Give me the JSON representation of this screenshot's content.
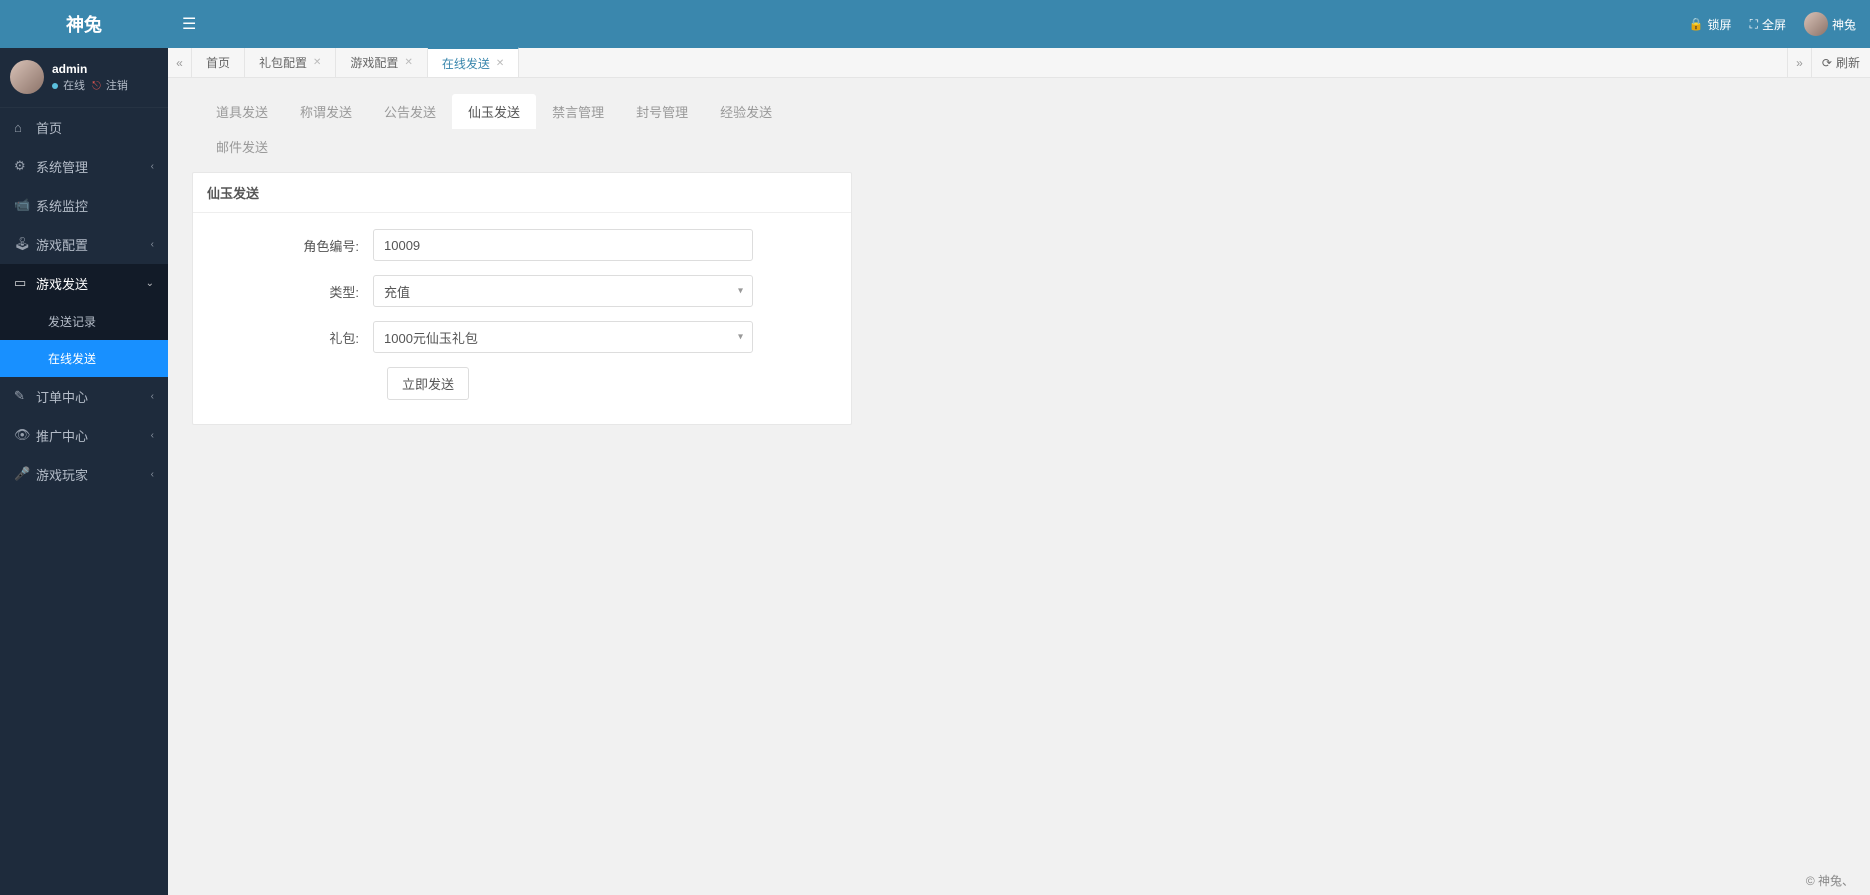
{
  "brand": "神兔",
  "user": {
    "name": "admin",
    "online": "在线",
    "logout": "注销"
  },
  "sidebar": [
    {
      "icon": "home",
      "label": "首页",
      "caret": false
    },
    {
      "icon": "gear",
      "label": "系统管理",
      "caret": true
    },
    {
      "icon": "camera",
      "label": "系统监控",
      "caret": false
    },
    {
      "icon": "dashboard",
      "label": "游戏配置",
      "caret": true
    },
    {
      "icon": "card",
      "label": "游戏发送",
      "caret": true,
      "open": true,
      "children": [
        {
          "label": "发送记录",
          "active": false
        },
        {
          "label": "在线发送",
          "active": true
        }
      ]
    },
    {
      "icon": "magic",
      "label": "订单中心",
      "caret": true
    },
    {
      "icon": "eye",
      "label": "推广中心",
      "caret": true
    },
    {
      "icon": "mic",
      "label": "游戏玩家",
      "caret": true
    }
  ],
  "topbar": {
    "lock": "锁屏",
    "fullscreen": "全屏",
    "username": "神兔"
  },
  "tabs": [
    {
      "label": "首页",
      "closable": false
    },
    {
      "label": "礼包配置",
      "closable": true
    },
    {
      "label": "游戏配置",
      "closable": true
    },
    {
      "label": "在线发送",
      "closable": true,
      "active": true
    }
  ],
  "refresh": "刷新",
  "subtabs_row1": [
    "道具发送",
    "称谓发送",
    "公告发送",
    "仙玉发送",
    "禁言管理",
    "封号管理",
    "经验发送"
  ],
  "subtabs_row2": [
    "邮件发送"
  ],
  "subtab_active": "仙玉发送",
  "panel": {
    "title": "仙玉发送",
    "fields": {
      "role_label": "角色编号:",
      "role_value": "10009",
      "type_label": "类型:",
      "type_value": "充值",
      "pack_label": "礼包:",
      "pack_value": "1000元仙玉礼包",
      "submit": "立即发送"
    }
  },
  "footer": "© 神兔、"
}
